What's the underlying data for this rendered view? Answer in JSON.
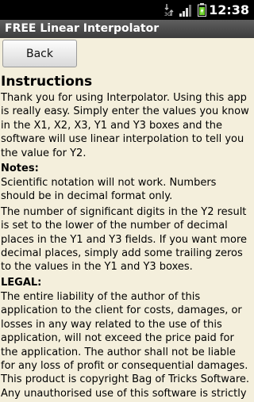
{
  "status_bar": {
    "time": "12:38",
    "icons": [
      "data-transfer-icon",
      "signal-strength-icon",
      "battery-charging-icon"
    ]
  },
  "app": {
    "title": "FREE Linear Interpolator"
  },
  "toolbar": {
    "back_label": "Back"
  },
  "content": {
    "instructions_heading": "Instructions",
    "instructions_text": "Thank you for using Interpolator. Using this app is really easy. Simply enter the values you know in the X1, X2, X3, Y1 and Y3 boxes and the software will use linear interpolation to tell you the value for Y2.",
    "notes_heading": "Notes:",
    "notes_text_1": "Scientific notation will not work. Numbers should be in decimal format only.",
    "notes_text_2": "The number of significant digits in the Y2 result is set to the lower of the number of decimal places in the Y1 and Y3 fields. If you want more decimal places, simply add some trailing zeros to the values in the Y1 and Y3 boxes.",
    "legal_heading": "LEGAL:",
    "legal_text": "The entire liability of the author of this application to the client for costs, damages, or losses in any way related to the use of this application, will not exceed the price paid for the application. The author shall not be liable for any loss of profit or consequential damages. This product is copyright Bag of Tricks Software. Any unauthorised use of this software is strictly"
  },
  "colors": {
    "background": "#f4efdc",
    "status_bar": "#000000",
    "title_bar": "#4a4a4a",
    "battery": "#6ed12b"
  }
}
